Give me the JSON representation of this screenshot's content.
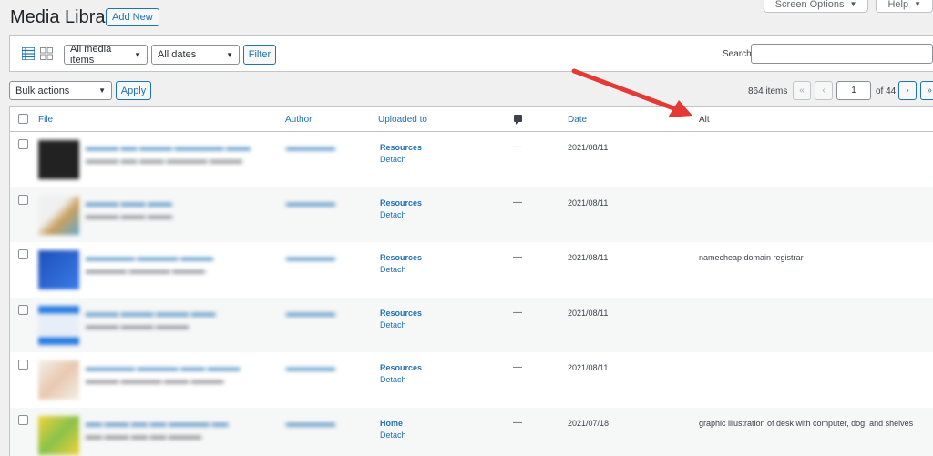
{
  "header": {
    "title": "Media Library",
    "add_new": "Add New",
    "screen_options": "Screen Options",
    "help": "Help"
  },
  "filters": {
    "media_type": "All media items",
    "dates": "All dates",
    "filter_btn": "Filter",
    "search_label": "Search",
    "search_value": ""
  },
  "bulk": {
    "select": "Bulk actions",
    "apply": "Apply"
  },
  "pagination": {
    "count": "864 items",
    "first": "«",
    "prev": "‹",
    "current": "1",
    "total": "of 44",
    "next": "›",
    "last": "»"
  },
  "table": {
    "columns": {
      "file": "File",
      "author": "Author",
      "uploaded": "Uploaded to",
      "date": "Date",
      "alt": "Alt"
    },
    "rows": [
      {
        "uploaded_to": "Resources",
        "detach": "Detach",
        "comments": "—",
        "date": "2021/08/11",
        "alt": ""
      },
      {
        "uploaded_to": "Resources",
        "detach": "Detach",
        "comments": "—",
        "date": "2021/08/11",
        "alt": ""
      },
      {
        "uploaded_to": "Resources",
        "detach": "Detach",
        "comments": "—",
        "date": "2021/08/11",
        "alt": "namecheap domain registrar"
      },
      {
        "uploaded_to": "Resources",
        "detach": "Detach",
        "comments": "—",
        "date": "2021/08/11",
        "alt": ""
      },
      {
        "uploaded_to": "Resources",
        "detach": "Detach",
        "comments": "—",
        "date": "2021/08/11",
        "alt": ""
      },
      {
        "uploaded_to": "Home",
        "detach": "Detach",
        "comments": "—",
        "date": "2021/07/18",
        "alt": "graphic illustration of desk with computer, dog, and shelves"
      }
    ]
  },
  "colors": {
    "link": "#2271b1",
    "annotation_arrow": "#e53935"
  }
}
